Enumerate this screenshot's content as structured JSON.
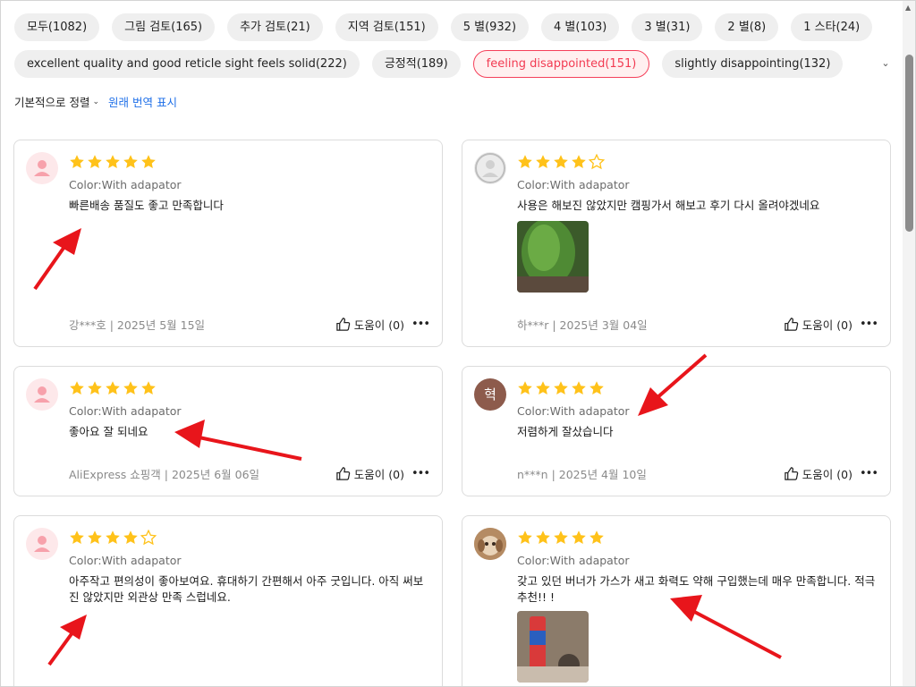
{
  "filters": {
    "row1": [
      "모두(1082)",
      "그림 검토(165)",
      "추가 검토(21)",
      "지역 검토(151)",
      "5 별(932)",
      "4 별(103)",
      "3 별(31)",
      "2 별(8)",
      "1 스타(24)"
    ],
    "row2": [
      "excellent quality and good reticle sight feels solid(222)",
      "긍정적(189)",
      "feeling disappointed(151)",
      "slightly disappointing(132)"
    ],
    "active": "feeling disappointed(151)",
    "expand_icon": "chevron-down-icon"
  },
  "sort": {
    "label": "기본적으로 정렬",
    "translate_link": "원래 번역 표시"
  },
  "colors": {
    "accent": "#f23b52",
    "star": "#ffc21a",
    "link": "#1e6fe8",
    "annotation_arrow": "#e8151b"
  },
  "reviews": [
    {
      "rating": 5,
      "color": "Color:With adapator",
      "text": "빠른배송 품질도 좋고 만족합니다",
      "reviewer": "강***호 | 2025년 5월 15일",
      "helpful": "도움이 (0)",
      "has_photo": false
    },
    {
      "rating": 4,
      "color": "Color:With adapator",
      "text": "사용은 해보진 않았지만 캠핑가서 해보고 후기 다시 올려야겠네요",
      "reviewer": "하***r | 2025년 3월 04일",
      "helpful": "도움이 (0)",
      "has_photo": true
    },
    {
      "rating": 5,
      "color": "Color:With adapator",
      "text": "좋아요 잘 되네요",
      "reviewer": "AliExpress 쇼핑객 | 2025년 6월 06일",
      "helpful": "도움이 (0)",
      "has_photo": false
    },
    {
      "rating": 5,
      "avatar_letter": "혁",
      "color": "Color:With adapator",
      "text": "저렴하게 잘샀습니다",
      "reviewer": "n***n | 2025년 4월 10일",
      "helpful": "도움이 (0)",
      "has_photo": false
    },
    {
      "rating": 4,
      "color": "Color:With adapator",
      "text": "아주작고 편의성이 좋아보여요. 휴대하기 간편해서 아주 굿입니다. 아직 써보진 않았지만 외관상 만족 스럽네요.",
      "has_photo": false
    },
    {
      "rating": 5,
      "color": "Color:With adapator",
      "text": "갖고 있던 버너가 가스가 새고 화력도 약해 구입했는데 매우 만족합니다. 적극 추천!! !",
      "has_photo": true
    }
  ],
  "icons": [
    "default-avatar-icon",
    "star-icon",
    "thumbs-up-icon",
    "more-icon",
    "chevron-down-icon"
  ]
}
